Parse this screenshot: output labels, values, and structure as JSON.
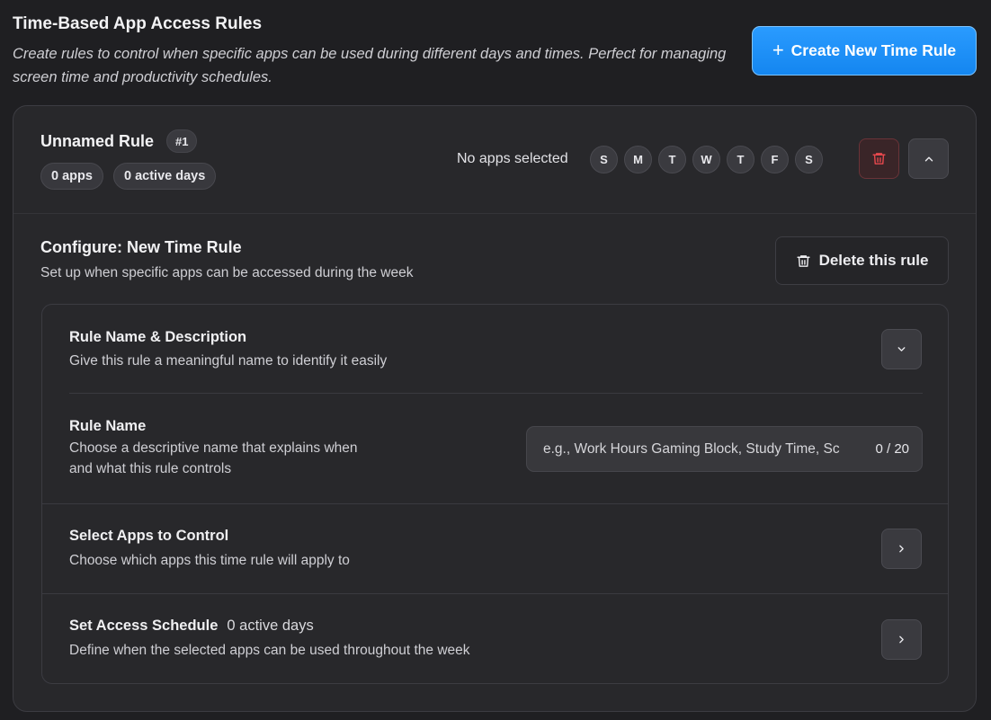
{
  "header": {
    "title": "Time-Based App Access Rules",
    "description": "Create rules to control when specific apps can be used during different days and times. Perfect for managing screen time and productivity schedules.",
    "create_button_icon": "plus-icon",
    "create_button_label": "Create New Time Rule"
  },
  "rule": {
    "name": "Unnamed Rule",
    "number": "#1",
    "apps_count": "0 apps",
    "active_days": "0 active days",
    "apps_status": "No apps selected",
    "days": [
      "S",
      "M",
      "T",
      "W",
      "T",
      "F",
      "S"
    ],
    "delete_icon": "trash-icon",
    "collapse_icon": "chevron-up-icon"
  },
  "config": {
    "title": "Configure: New Time Rule",
    "subtitle": "Set up when specific apps can be accessed during the week",
    "delete_rule_label": "Delete this rule",
    "sections": {
      "name_desc": {
        "title": "Rule Name & Description",
        "desc": "Give this rule a meaningful name to identify it easily",
        "toggle_icon": "chevron-down-icon"
      },
      "rule_name": {
        "title": "Rule Name",
        "desc_line1": "Choose a descriptive name that explains when",
        "desc_line2": "and what this rule controls",
        "placeholder": "e.g., Work Hours Gaming Block, Study Time, Sc",
        "value": "",
        "counter": "0 / 20"
      },
      "select_apps": {
        "title": "Select Apps to Control",
        "desc": "Choose which apps this time rule will apply to",
        "nav_icon": "chevron-right-icon"
      },
      "schedule": {
        "title": "Set Access Schedule",
        "badge": "0 active days",
        "desc": "Define when the selected apps can be used throughout the week",
        "nav_icon": "chevron-right-icon"
      }
    }
  },
  "colors": {
    "background": "#1f1f22",
    "card": "#28282b",
    "accent": "#1e90ff",
    "danger": "#e5484d"
  }
}
